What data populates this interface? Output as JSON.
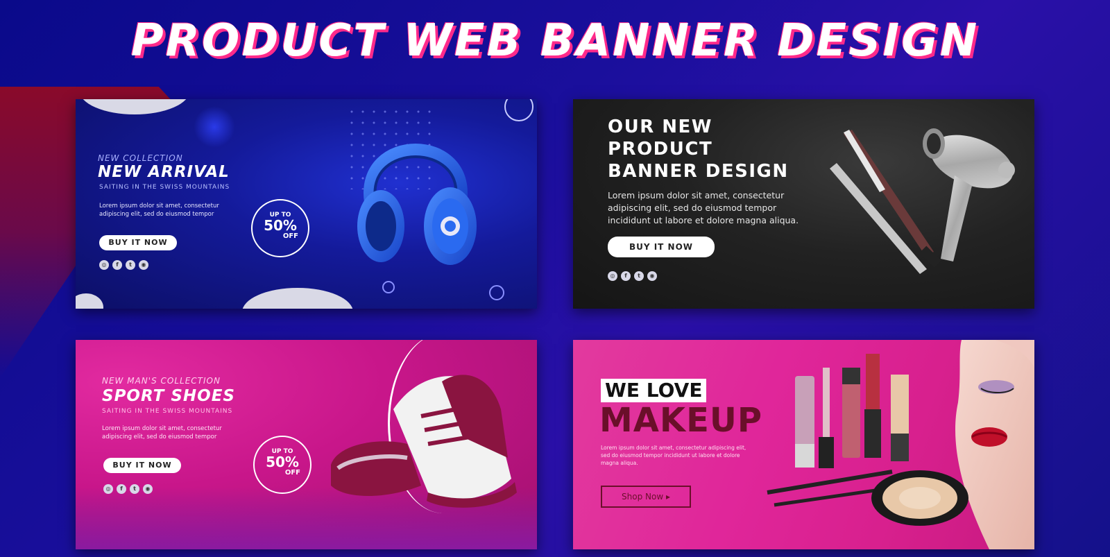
{
  "title": "PRODUCT WEB BANNER DESIGN",
  "banners": [
    {
      "kicker": "NEW COLLECTION",
      "headline": "NEW ARRIVAL",
      "subline": "SAITING IN THE SWISS MOUNTAINS",
      "lorem": "Lorem ipsum dolor sit amet, consectetur adipiscing elit, sed do eiusmod tempor",
      "button": "BUY IT NOW",
      "badge": {
        "up": "UP TO",
        "pct": "50%",
        "off": "OFF"
      },
      "socials": [
        "instagram-icon",
        "facebook-icon",
        "twitter-icon",
        "web-icon"
      ]
    },
    {
      "headline_lines": [
        "OUR NEW",
        "PRODUCT",
        "BANNER DESIGN"
      ],
      "lorem_lines": [
        "Lorem ipsum dolor sit amet, consectetur",
        "adipiscing elit, sed do eiusmod tempor",
        "incididunt ut labore et dolore magna aliqua."
      ],
      "button": "BUY IT NOW",
      "socials": [
        "instagram-icon",
        "facebook-icon",
        "twitter-icon",
        "web-icon"
      ]
    },
    {
      "kicker": "NEW MAN'S COLLECTION",
      "headline": "SPORT SHOES",
      "subline": "SAITING IN THE SWISS MOUNTAINS",
      "lorem": "Lorem ipsum dolor sit amet, consectetur adipiscing elit, sed do eiusmod tempor",
      "button": "BUY IT NOW",
      "badge": {
        "up": "UP TO",
        "pct": "50%",
        "off": "OFF"
      },
      "socials": [
        "instagram-icon",
        "facebook-icon",
        "twitter-icon",
        "web-icon"
      ]
    },
    {
      "tag": "WE LOVE",
      "headline": "MAKEUP",
      "lorem": "Lorem ipsum dolor sit amet, consectetur adipiscing elit, sed do eiusmod tempor incididunt ut labore et dolore magna aliqua.",
      "button": "Shop Now",
      "button_arrow": "▸"
    }
  ],
  "colors": {
    "title_shadow": "#ff2a8a",
    "dark_pink_text": "#6a0f2a",
    "banner1_bg": "#141a9a",
    "banner2_bg": "#222222",
    "banner3_bg": "#c8168a",
    "banner4_bg": "#e0269a"
  }
}
